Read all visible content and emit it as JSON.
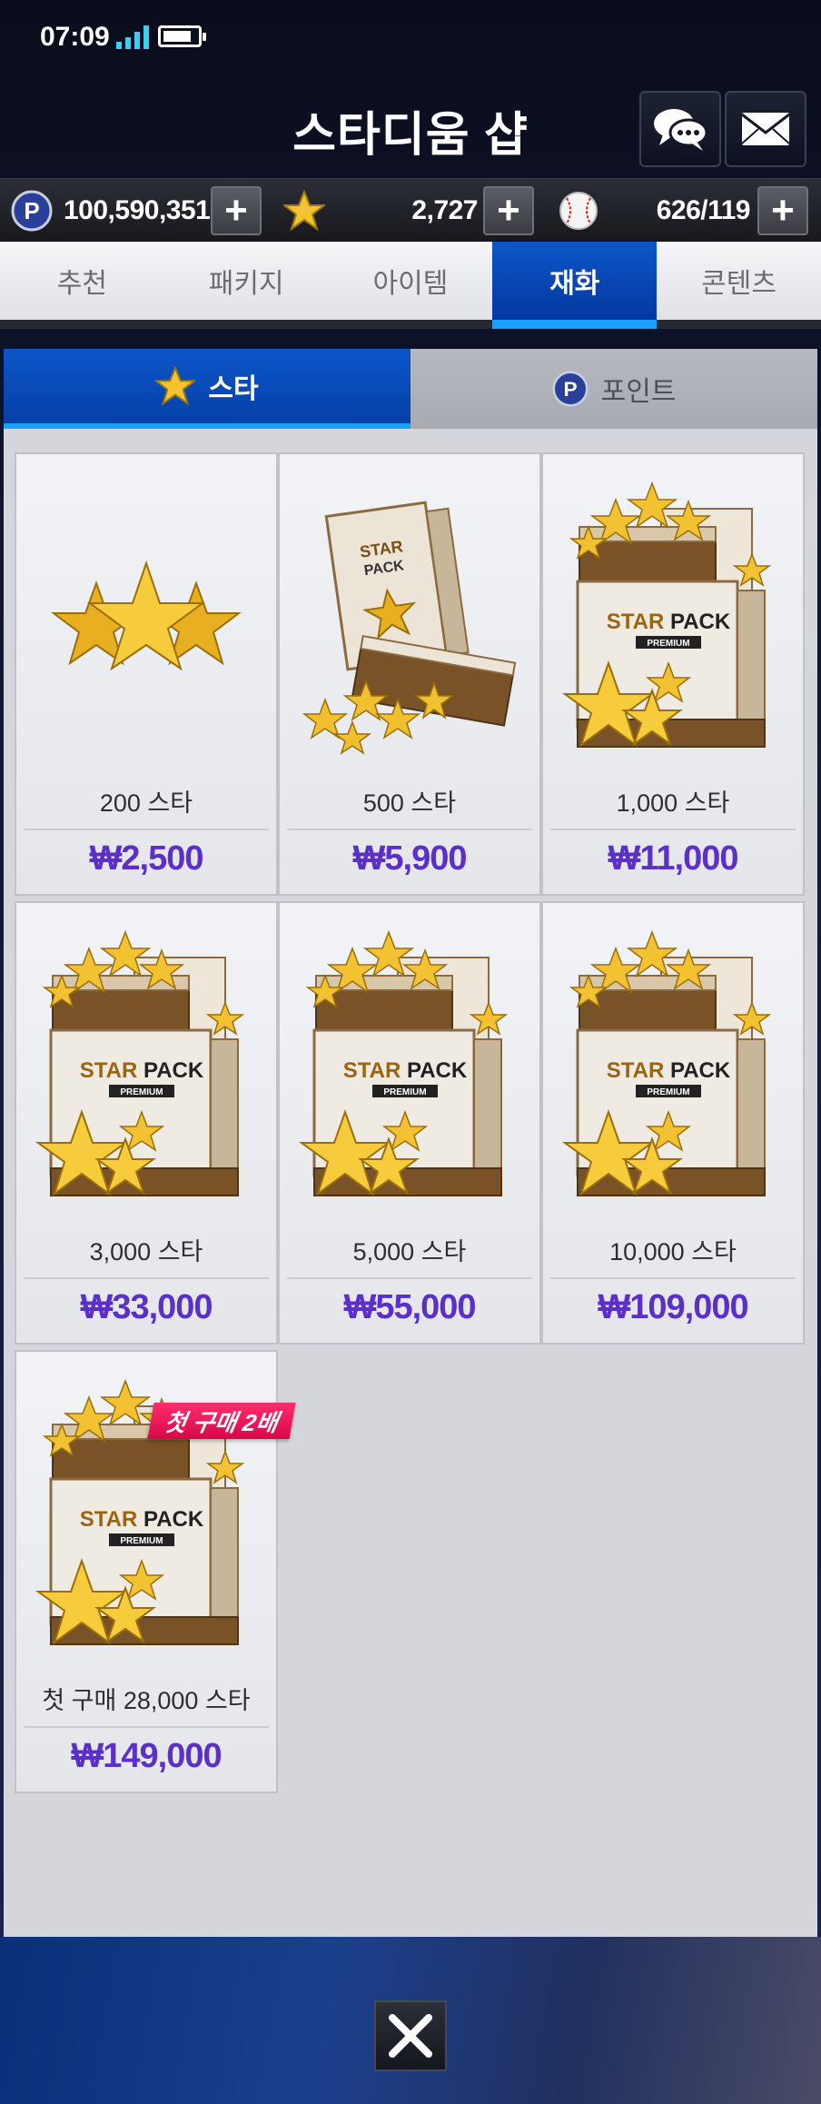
{
  "status_bar": {
    "time": "07:09",
    "battery_level": 0.82
  },
  "header": {
    "title": "스타디움 샵",
    "chat_icon": "chat-bubbles-icon",
    "mail_icon": "mail-icon"
  },
  "currency": {
    "points": {
      "icon": "p-coin-icon",
      "value": "100,590,351"
    },
    "stars": {
      "icon": "star-icon",
      "value": "2,727"
    },
    "balls": {
      "icon": "baseball-icon",
      "value": "626/119"
    }
  },
  "tabs": [
    "추천",
    "패키지",
    "아이템",
    "재화",
    "콘텐츠"
  ],
  "active_tab": "재화",
  "subtabs": {
    "star": "스타",
    "point": "포인트"
  },
  "products": [
    {
      "name": "200 스타",
      "price": "₩2,500",
      "art": "stars-icon"
    },
    {
      "name": "500 스타",
      "price": "₩5,900",
      "art": "star-pack-open-icon"
    },
    {
      "name": "1,000 스타",
      "price": "₩11,000",
      "art": "star-pack-premium-icon"
    },
    {
      "name": "3,000 스타",
      "price": "₩33,000",
      "art": "star-pack-premium-icon"
    },
    {
      "name": "5,000 스타",
      "price": "₩55,000",
      "art": "star-pack-premium-icon"
    },
    {
      "name": "10,000 스타",
      "price": "₩109,000",
      "art": "star-pack-premium-icon"
    },
    {
      "name": "첫 구매 28,000 스타",
      "price": "₩149,000",
      "art": "star-pack-premium-icon",
      "badge": "첫 구매 2배"
    }
  ],
  "pack_labels": {
    "star": "STAR",
    "pack": "PACK",
    "premium": "PREMIUM"
  },
  "colors": {
    "accent_blue": "#0d56c8",
    "price_purple": "#5a30c8",
    "badge_pink": "#ff2d6e"
  }
}
